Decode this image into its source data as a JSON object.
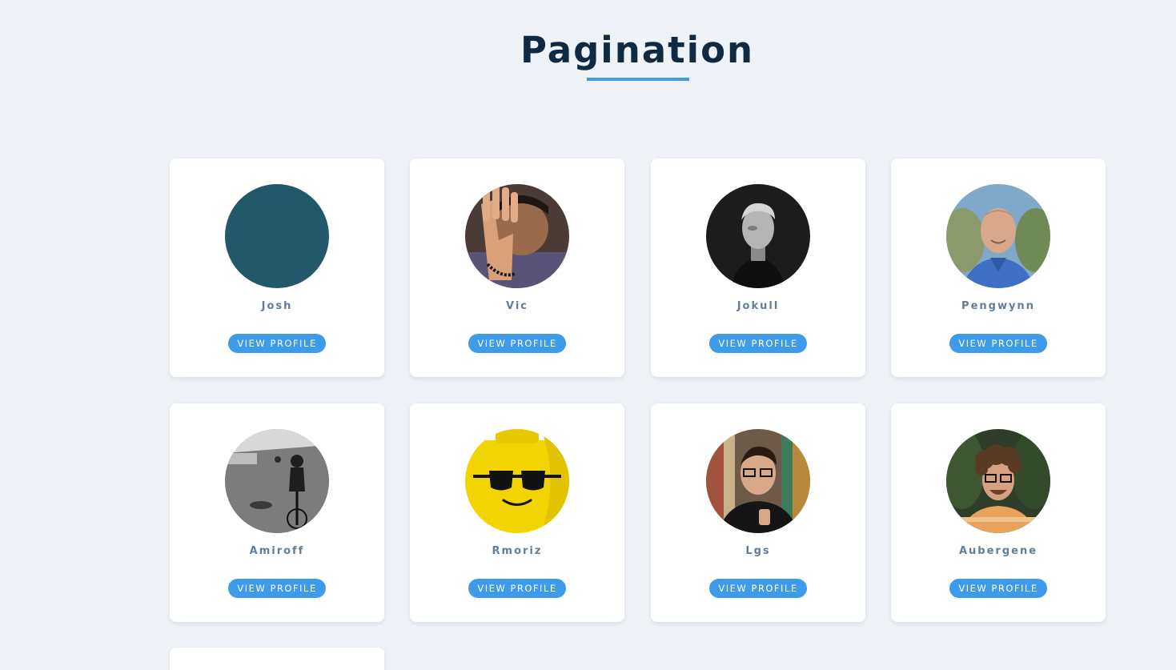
{
  "page": {
    "title": "Pagination",
    "accent_color": "#3d9be9",
    "background_color": "#eff3f7",
    "title_color": "#102a43"
  },
  "cards": [
    {
      "name": "Josh",
      "button_label": "VIEW PROFILE",
      "avatar": "solid-teal-circle"
    },
    {
      "name": "Vic",
      "button_label": "VIEW PROFILE",
      "avatar": "boy-raising-hand-photo"
    },
    {
      "name": "Jokull",
      "button_label": "VIEW PROFILE",
      "avatar": "black-and-white-portrait"
    },
    {
      "name": "Pengwynn",
      "button_label": "VIEW PROFILE",
      "avatar": "smiling-man-outdoors-photo"
    },
    {
      "name": "Amiroff",
      "button_label": "VIEW PROFILE",
      "avatar": "cyclist-street-photo"
    },
    {
      "name": "Rmoriz",
      "button_label": "VIEW PROFILE",
      "avatar": "lego-head-sunglasses"
    },
    {
      "name": "Lgs",
      "button_label": "VIEW PROFILE",
      "avatar": "man-with-glasses-bookshelf-photo"
    },
    {
      "name": "Aubergene",
      "button_label": "VIEW PROFILE",
      "avatar": "curly-hair-man-glasses-photo"
    }
  ]
}
